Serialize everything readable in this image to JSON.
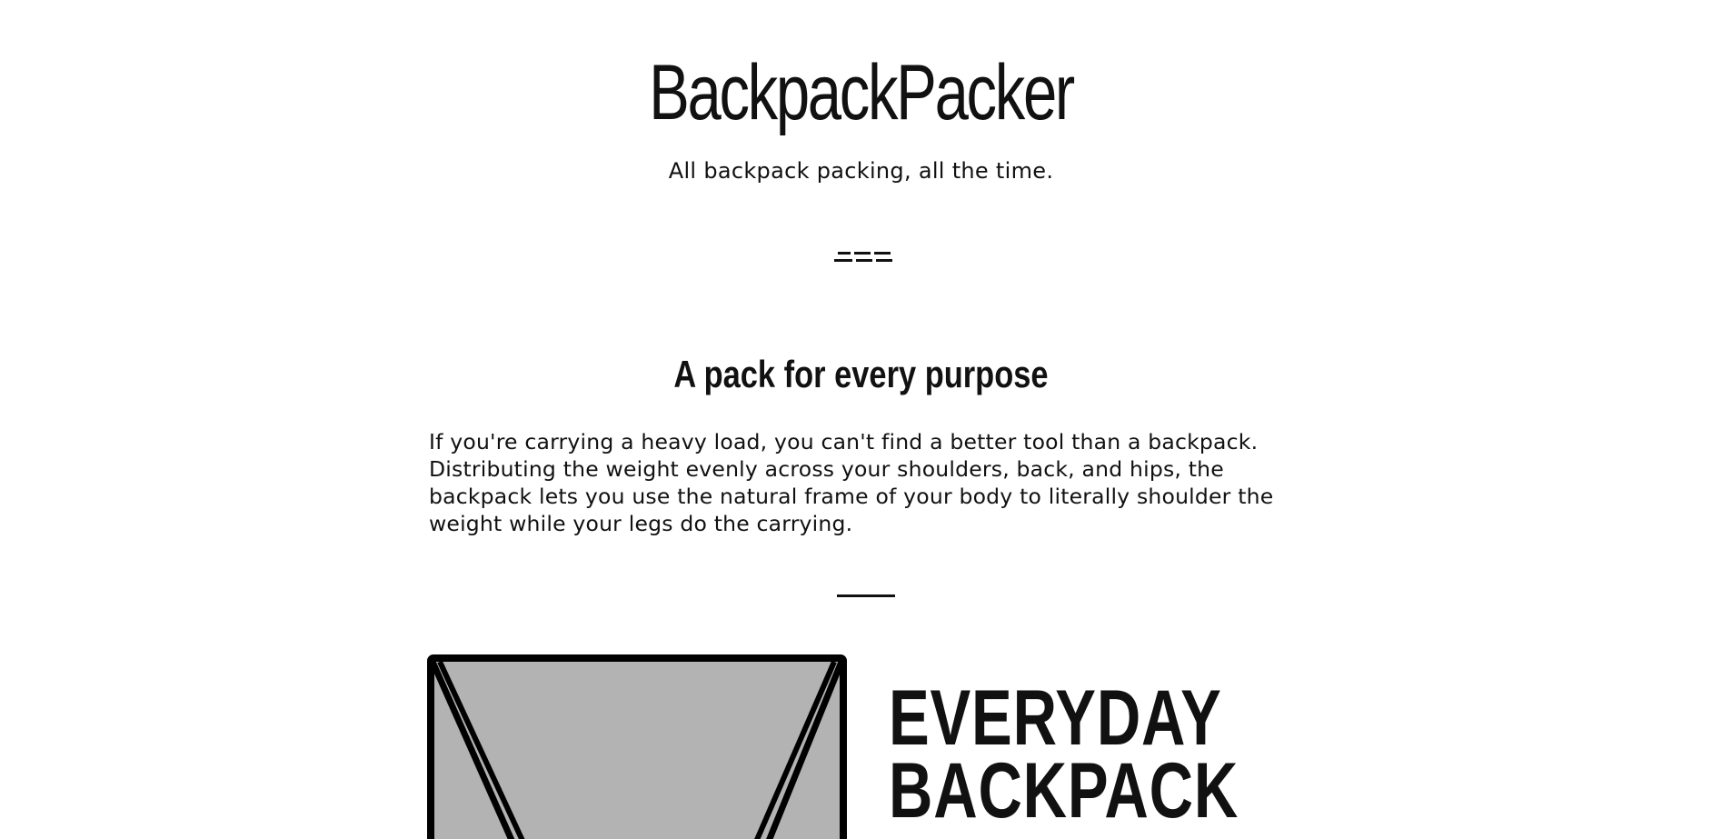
{
  "site": {
    "title": "BackpackPacker",
    "tagline": "All backpack packing, all the time."
  },
  "section": {
    "title": "A pack for every purpose",
    "intro": "If you're carrying a heavy load, you can't find a better tool than a backpack. Distributing the weight evenly across your shoulders, back, and hips, the backpack lets you use the natural frame of your body to literally shoulder the weight while your legs do the carrying."
  },
  "product": {
    "name_line1": "EVERYDAY",
    "name_line2": "BACKPACK",
    "image_icon": "backpack-illustration",
    "image_fill": "#b3b3b3",
    "image_stroke": "#000000"
  },
  "colors": {
    "text": "#111111",
    "background": "#ffffff"
  }
}
